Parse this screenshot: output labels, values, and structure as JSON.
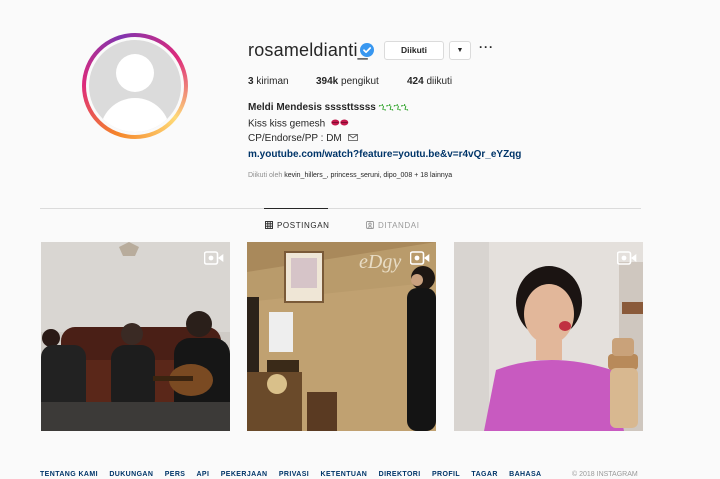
{
  "profile": {
    "username": "rosameldianti_",
    "follow_label": "Diikuti",
    "dropdown_icon": "caret-down-icon",
    "more_label": "···"
  },
  "stats": {
    "posts_count": "3",
    "posts_label": "kiriman",
    "followers_count": "394k",
    "followers_label": "pengikut",
    "following_count": "424",
    "following_label": "diikuti"
  },
  "bio": {
    "name": "Meldi Mendesis ssssttssss",
    "squiggles": "ኂኂኂኂ",
    "line2": "Kiss kiss gemesh",
    "line3": "CP/Endorse/PP : DM",
    "link": "m.youtube.com/watch?feature=youtu.be&v=r4vQr_eYZqg"
  },
  "followed_by": {
    "prefix": "Diikuti oleh",
    "users": "kevin_hillers_, princess_seruni, dipo_008",
    "suffix": "+ 18 lainnya"
  },
  "tabs": [
    {
      "label": "POSTINGAN",
      "active": true
    },
    {
      "label": "DITANDAI",
      "active": false
    }
  ],
  "posts": [
    {
      "type": "video",
      "icon": "video-icon"
    },
    {
      "type": "video",
      "icon": "video-icon"
    },
    {
      "type": "video",
      "icon": "video-icon"
    }
  ],
  "footer": {
    "links": [
      "TENTANG KAMI",
      "DUKUNGAN",
      "PERS",
      "API",
      "PEKERJAAN",
      "PRIVASI",
      "KETENTUAN",
      "DIREKTORI",
      "PROFIL",
      "TAGAR",
      "BAHASA"
    ],
    "copyright": "© 2018 INSTAGRAM"
  },
  "colors": {
    "link": "#003569",
    "verified": "#3897f0",
    "border": "#dbdbdb",
    "muted": "#8e8e8e"
  }
}
